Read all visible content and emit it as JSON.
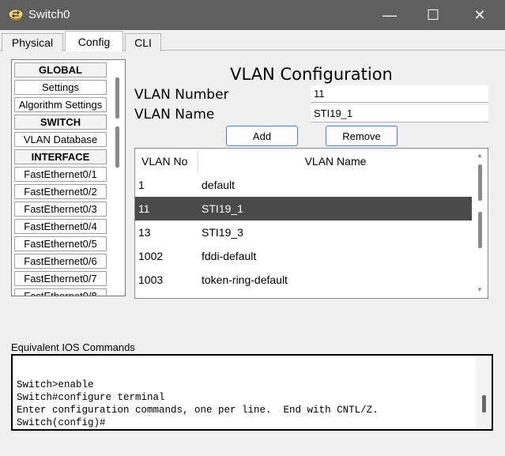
{
  "window": {
    "title": "Switch0",
    "minimize": "—",
    "maximize": "☐",
    "close": "✕"
  },
  "tabs": [
    {
      "label": "Physical"
    },
    {
      "label": "Config"
    },
    {
      "label": "CLI"
    }
  ],
  "sidebar": {
    "items": [
      {
        "label": "GLOBAL",
        "header": true
      },
      {
        "label": "Settings"
      },
      {
        "label": "Algorithm Settings"
      },
      {
        "label": "SWITCH",
        "header": true
      },
      {
        "label": "VLAN Database"
      },
      {
        "label": "INTERFACE",
        "header": true
      },
      {
        "label": "FastEthernet0/1"
      },
      {
        "label": "FastEthernet0/2"
      },
      {
        "label": "FastEthernet0/3"
      },
      {
        "label": "FastEthernet0/4"
      },
      {
        "label": "FastEthernet0/5"
      },
      {
        "label": "FastEthernet0/6"
      },
      {
        "label": "FastEthernet0/7"
      },
      {
        "label": "FastEthernet0/8"
      }
    ]
  },
  "vlan_config": {
    "title": "VLAN Configuration",
    "number_label": "VLAN Number",
    "number_value": "11",
    "name_label": "VLAN Name",
    "name_value": "STI19_1",
    "add_label": "Add",
    "remove_label": "Remove",
    "table": {
      "headers": {
        "no": "VLAN No",
        "name": "VLAN Name"
      },
      "rows": [
        {
          "no": "1",
          "name": "default"
        },
        {
          "no": "11",
          "name": "STI19_1",
          "selected": true
        },
        {
          "no": "13",
          "name": "STI19_3"
        },
        {
          "no": "1002",
          "name": "fddi-default"
        },
        {
          "no": "1003",
          "name": "token-ring-default"
        }
      ]
    }
  },
  "ios": {
    "label": "Equivalent IOS Commands",
    "lines": [
      "",
      "Switch>enable",
      "Switch#configure terminal",
      "Enter configuration commands, one per line.  End with CNTL/Z.",
      "Switch(config)#"
    ]
  },
  "colors": {
    "titlebar": "#5f5f5f",
    "selected_row": "#4a4a4a",
    "button_border": "#4a7cc7"
  }
}
